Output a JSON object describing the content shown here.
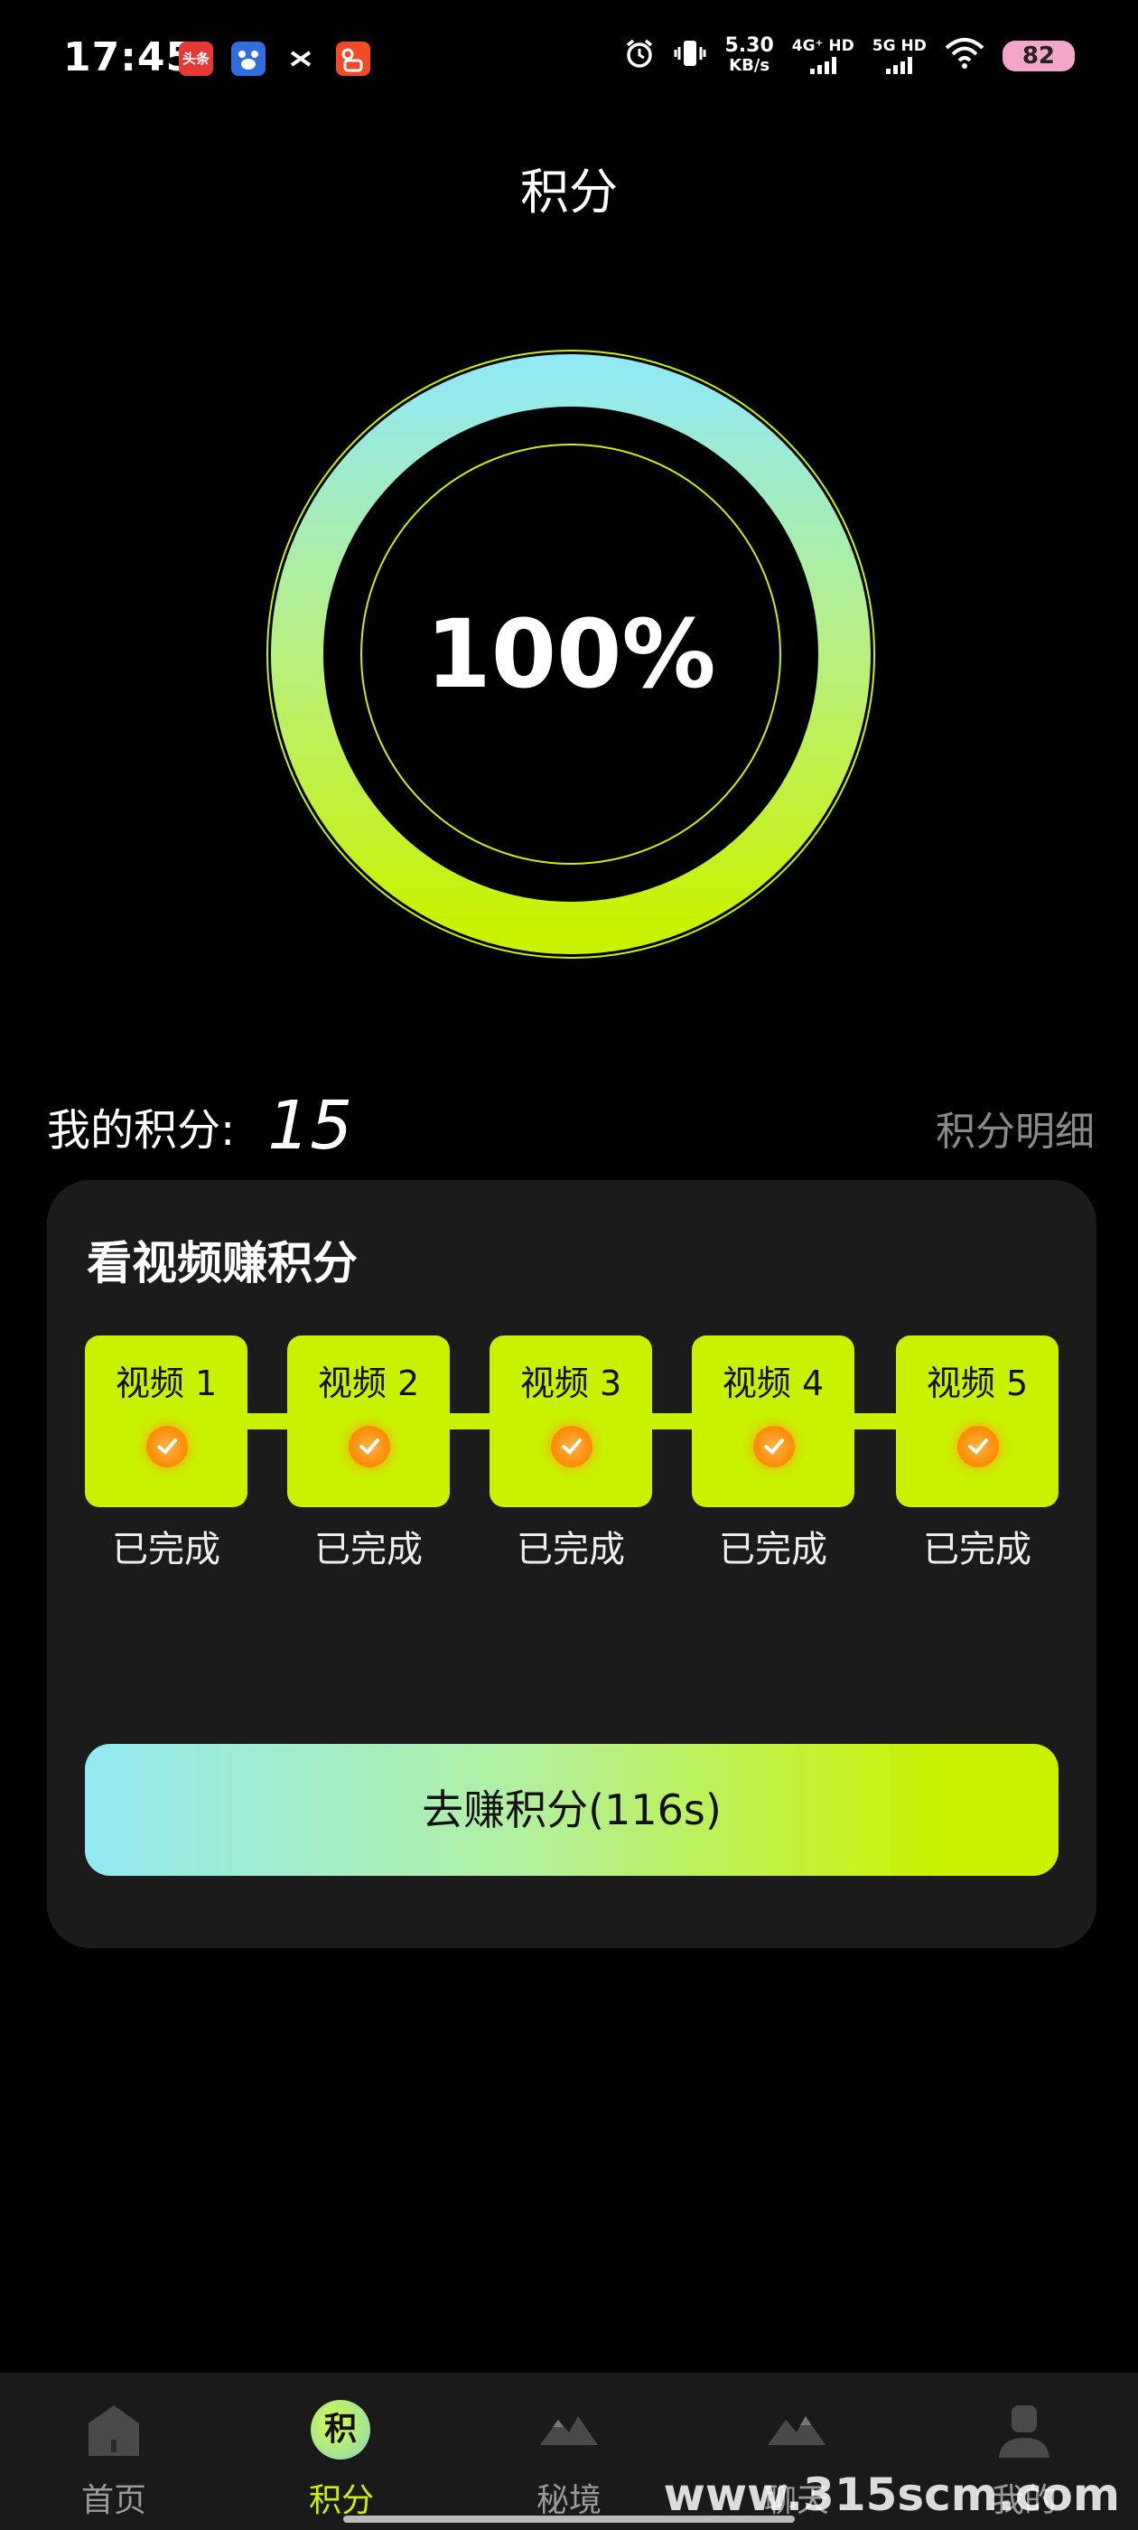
{
  "status_bar": {
    "time": "17:45",
    "app_icons": [
      {
        "label": "头条",
        "color": "#e53935"
      },
      {
        "label": "",
        "color": "#2f6de1"
      },
      {
        "label": "",
        "color": "#000000"
      },
      {
        "label": "",
        "color": "#f04a2a"
      }
    ],
    "net_speed_value": "5.30",
    "net_speed_unit": "KB/s",
    "signal_1": "4G⁺ HD",
    "signal_2": "5G HD",
    "battery": "82"
  },
  "page_title": "积分",
  "progress": {
    "percent_text": "100%",
    "value": 1.0
  },
  "my_points": {
    "label": "我的积分:",
    "value": "15",
    "detail_link": "积分明细"
  },
  "card": {
    "title": "看视频赚积分",
    "videos": [
      {
        "label": "视频 1",
        "status": "已完成"
      },
      {
        "label": "视频 2",
        "status": "已完成"
      },
      {
        "label": "视频 3",
        "status": "已完成"
      },
      {
        "label": "视频 4",
        "status": "已完成"
      },
      {
        "label": "视频 5",
        "status": "已完成"
      }
    ],
    "earn_button": "去赚积分(116s)"
  },
  "tabs": [
    {
      "label": "首页",
      "icon": "home-icon"
    },
    {
      "label": "积分",
      "icon": "points-icon",
      "icon_text": "积",
      "active": true
    },
    {
      "label": "秘境",
      "icon": "mountain-icon"
    },
    {
      "label": "聊天",
      "icon": "chat-icon"
    },
    {
      "label": "我的",
      "icon": "profile-icon"
    }
  ],
  "watermark": "www.315scm.com",
  "colors": {
    "accent": "#c9f200",
    "ring_end": "#93e9f2",
    "card_bg": "#1b1b1b"
  }
}
